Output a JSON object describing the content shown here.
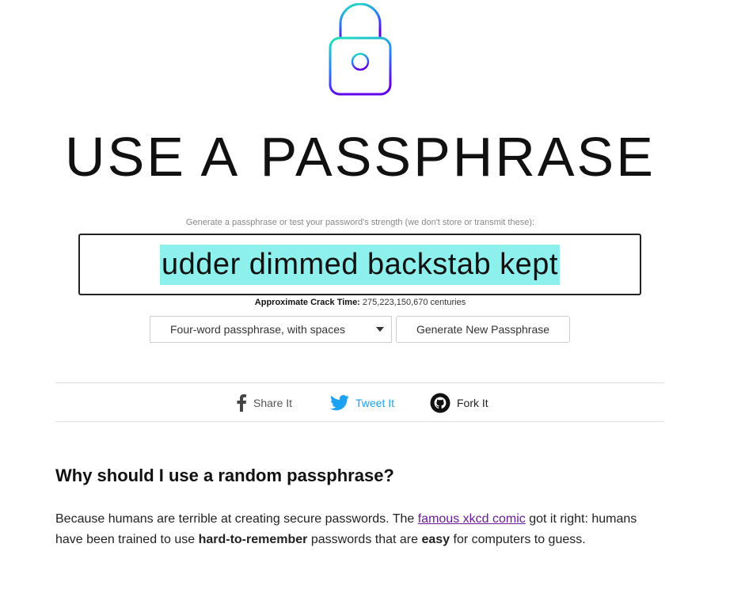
{
  "logo": {
    "icon": "padlock-icon",
    "gradient": [
      "#1de9b6",
      "#2979ff",
      "#6200ea"
    ]
  },
  "title": {
    "light": "USE A",
    "bold": "PASSPHRASE"
  },
  "hint": "Generate a passphrase or test your password's strength (we don't store or transmit these):",
  "passphrase": {
    "value": "udder dimmed backstab kept",
    "highlight_color": "#8ef0ec"
  },
  "crack_time": {
    "label": "Approximate Crack Time:",
    "value": "275,223,150,670 centuries"
  },
  "controls": {
    "mode_select": "Four-word passphrase, with spaces",
    "generate_button": "Generate New Passphrase"
  },
  "share": {
    "facebook": {
      "icon": "facebook-icon",
      "label": "Share It"
    },
    "twitter": {
      "icon": "twitter-icon",
      "label": "Tweet It",
      "color": "#1da1f2"
    },
    "github": {
      "icon": "github-icon",
      "label": "Fork It"
    }
  },
  "faq": {
    "heading": "Why should I use a random passphrase?",
    "p1": "Because humans are terrible at creating secure passwords. The ",
    "link": "famous xkcd comic",
    "p2": " got it right: humans have been trained to use ",
    "b1": "hard-to-remember",
    "p3": " passwords that are ",
    "b2": "easy",
    "p4": " for computers to guess."
  }
}
